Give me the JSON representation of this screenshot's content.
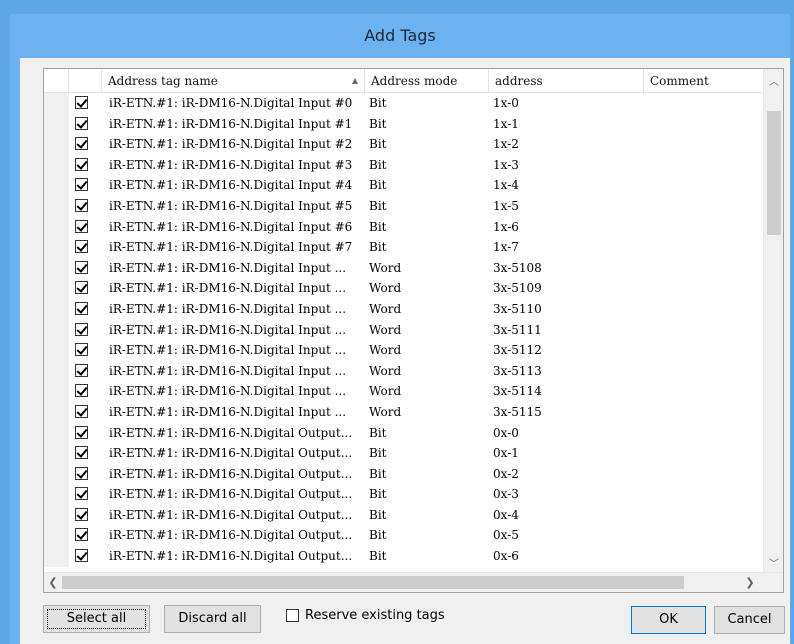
{
  "window": {
    "title": "Add Tags"
  },
  "table": {
    "columns": [
      "Address tag name",
      "Address mode",
      "address",
      "Comment"
    ],
    "rows": [
      {
        "checked": true,
        "name": "iR-ETN.#1: iR-DM16-N.Digital Input #0",
        "mode": "Bit",
        "address": "1x-0",
        "comment": ""
      },
      {
        "checked": true,
        "name": "iR-ETN.#1: iR-DM16-N.Digital Input #1",
        "mode": "Bit",
        "address": "1x-1",
        "comment": ""
      },
      {
        "checked": true,
        "name": "iR-ETN.#1: iR-DM16-N.Digital Input #2",
        "mode": "Bit",
        "address": "1x-2",
        "comment": ""
      },
      {
        "checked": true,
        "name": "iR-ETN.#1: iR-DM16-N.Digital Input #3",
        "mode": "Bit",
        "address": "1x-3",
        "comment": ""
      },
      {
        "checked": true,
        "name": "iR-ETN.#1: iR-DM16-N.Digital Input #4",
        "mode": "Bit",
        "address": "1x-4",
        "comment": ""
      },
      {
        "checked": true,
        "name": "iR-ETN.#1: iR-DM16-N.Digital Input #5",
        "mode": "Bit",
        "address": "1x-5",
        "comment": ""
      },
      {
        "checked": true,
        "name": "iR-ETN.#1: iR-DM16-N.Digital Input #6",
        "mode": "Bit",
        "address": "1x-6",
        "comment": ""
      },
      {
        "checked": true,
        "name": "iR-ETN.#1: iR-DM16-N.Digital Input #7",
        "mode": "Bit",
        "address": "1x-7",
        "comment": ""
      },
      {
        "checked": true,
        "name": "iR-ETN.#1: iR-DM16-N.Digital Input ...",
        "mode": "Word",
        "address": "3x-5108",
        "comment": ""
      },
      {
        "checked": true,
        "name": "iR-ETN.#1: iR-DM16-N.Digital Input ...",
        "mode": "Word",
        "address": "3x-5109",
        "comment": ""
      },
      {
        "checked": true,
        "name": "iR-ETN.#1: iR-DM16-N.Digital Input ...",
        "mode": "Word",
        "address": "3x-5110",
        "comment": ""
      },
      {
        "checked": true,
        "name": "iR-ETN.#1: iR-DM16-N.Digital Input ...",
        "mode": "Word",
        "address": "3x-5111",
        "comment": ""
      },
      {
        "checked": true,
        "name": "iR-ETN.#1: iR-DM16-N.Digital Input ...",
        "mode": "Word",
        "address": "3x-5112",
        "comment": ""
      },
      {
        "checked": true,
        "name": "iR-ETN.#1: iR-DM16-N.Digital Input ...",
        "mode": "Word",
        "address": "3x-5113",
        "comment": ""
      },
      {
        "checked": true,
        "name": "iR-ETN.#1: iR-DM16-N.Digital Input ...",
        "mode": "Word",
        "address": "3x-5114",
        "comment": ""
      },
      {
        "checked": true,
        "name": "iR-ETN.#1: iR-DM16-N.Digital Input ...",
        "mode": "Word",
        "address": "3x-5115",
        "comment": ""
      },
      {
        "checked": true,
        "name": "iR-ETN.#1: iR-DM16-N.Digital Output...",
        "mode": "Bit",
        "address": "0x-0",
        "comment": ""
      },
      {
        "checked": true,
        "name": "iR-ETN.#1: iR-DM16-N.Digital Output...",
        "mode": "Bit",
        "address": "0x-1",
        "comment": ""
      },
      {
        "checked": true,
        "name": "iR-ETN.#1: iR-DM16-N.Digital Output...",
        "mode": "Bit",
        "address": "0x-2",
        "comment": ""
      },
      {
        "checked": true,
        "name": "iR-ETN.#1: iR-DM16-N.Digital Output...",
        "mode": "Bit",
        "address": "0x-3",
        "comment": ""
      },
      {
        "checked": true,
        "name": "iR-ETN.#1: iR-DM16-N.Digital Output...",
        "mode": "Bit",
        "address": "0x-4",
        "comment": ""
      },
      {
        "checked": true,
        "name": "iR-ETN.#1: iR-DM16-N.Digital Output...",
        "mode": "Bit",
        "address": "0x-5",
        "comment": ""
      },
      {
        "checked": true,
        "name": "iR-ETN.#1: iR-DM16-N.Digital Output...",
        "mode": "Bit",
        "address": "0x-6",
        "comment": ""
      }
    ]
  },
  "icons": {
    "sort": "sort-ascending-icon",
    "scroll_up": "chevron-up-icon",
    "scroll_down": "chevron-down-icon",
    "scroll_left": "chevron-left-icon",
    "scroll_right": "chevron-right-icon"
  },
  "buttons": {
    "select_all": "Select all",
    "discard_all": "Discard all",
    "ok": "OK",
    "cancel": "Cancel"
  },
  "options": {
    "reserve_label": "Reserve existing tags",
    "reserve_checked": false
  },
  "colors": {
    "title_bar": "#6cb2f0",
    "client_bg": "#f0f0f0",
    "default_button_border": "#0078d7"
  }
}
